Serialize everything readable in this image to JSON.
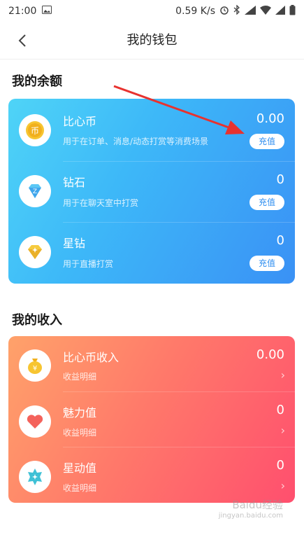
{
  "status_bar": {
    "time": "21:00",
    "net_speed": "0.59 K/s"
  },
  "header": {
    "title": "我的钱包"
  },
  "balance_section": {
    "title": "我的余额",
    "items": [
      {
        "name": "比心币",
        "desc": "用于在订单、消息/动态打赏等消费场景",
        "value": "0.00",
        "button": "充值",
        "icon": "coin-icon"
      },
      {
        "name": "钻石",
        "desc": "用于在聊天室中打赏",
        "value": "0",
        "button": "充值",
        "icon": "diamond-icon"
      },
      {
        "name": "星钻",
        "desc": "用于直播打赏",
        "value": "0",
        "button": "充值",
        "icon": "gold-diamond-icon"
      }
    ]
  },
  "income_section": {
    "title": "我的收入",
    "items": [
      {
        "name": "比心币收入",
        "desc": "收益明细",
        "value": "0.00",
        "icon": "money-bag-icon"
      },
      {
        "name": "魅力值",
        "desc": "收益明细",
        "value": "0",
        "icon": "heart-icon"
      },
      {
        "name": "星动值",
        "desc": "收益明细",
        "value": "0",
        "icon": "star-badge-icon"
      }
    ]
  },
  "watermark": {
    "brand": "Baidu经验",
    "url": "jingyan.baidu.com"
  },
  "colors": {
    "balance_gradient": [
      "#4fd4f7",
      "#3a91f5"
    ],
    "income_gradient": [
      "#ffa26a",
      "#ff4f6e"
    ],
    "annotation_arrow": "#e8322f"
  }
}
